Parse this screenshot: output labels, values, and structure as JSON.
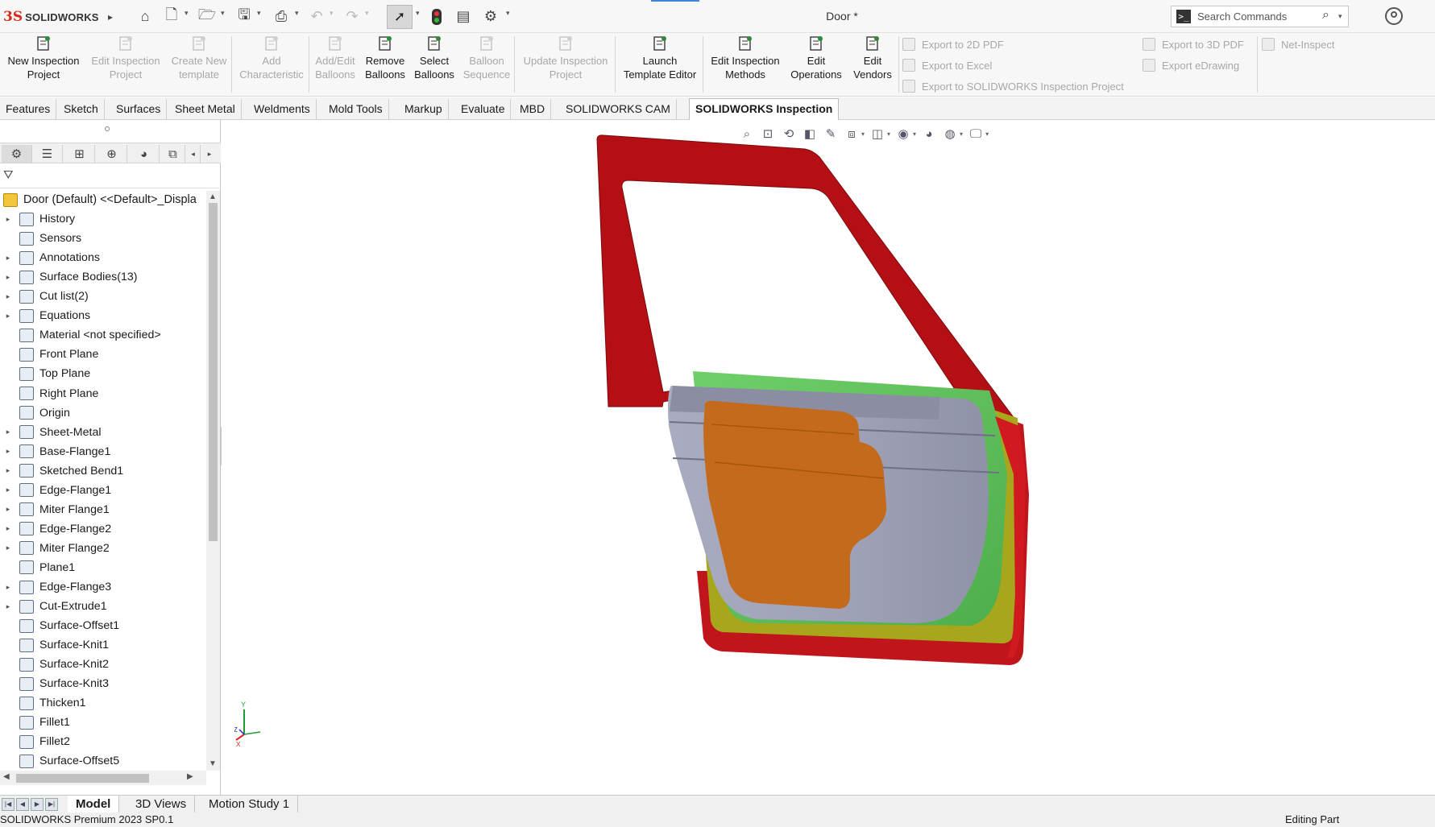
{
  "app": {
    "logo_mark": "3S",
    "logo_text": "SOLIDWORKS",
    "document_title": "Door *",
    "search_placeholder": "Search Commands"
  },
  "ribbon": {
    "buttons": [
      {
        "label1": "New Inspection",
        "label2": "Project",
        "enabled": true
      },
      {
        "label1": "Edit Inspection",
        "label2": "Project",
        "enabled": false
      },
      {
        "label1": "Create New",
        "label2": "template",
        "enabled": false
      },
      {
        "label1": "Add",
        "label2": "Characteristic",
        "enabled": false
      },
      {
        "label1": "Add/Edit",
        "label2": "Balloons",
        "enabled": false
      },
      {
        "label1": "Remove",
        "label2": "Balloons",
        "enabled": true
      },
      {
        "label1": "Select",
        "label2": "Balloons",
        "enabled": true
      },
      {
        "label1": "Balloon",
        "label2": "Sequence",
        "enabled": false
      },
      {
        "label1": "Update Inspection",
        "label2": "Project",
        "enabled": false
      },
      {
        "label1": "Launch",
        "label2": "Template Editor",
        "enabled": true
      },
      {
        "label1": "Edit Inspection",
        "label2": "Methods",
        "enabled": true
      },
      {
        "label1": "Edit",
        "label2": "Operations",
        "enabled": true
      },
      {
        "label1": "Edit",
        "label2": "Vendors",
        "enabled": true
      }
    ],
    "export": {
      "pdf2d": "Export to 2D PDF",
      "excel": "Export to Excel",
      "sw_project": "Export to SOLIDWORKS Inspection Project",
      "pdf3d": "Export to 3D PDF",
      "edrawing": "Export eDrawing",
      "net_inspect": "Net-Inspect"
    }
  },
  "command_tabs": [
    "Features",
    "Sketch",
    "Surfaces",
    "Sheet Metal",
    "Weldments",
    "Mold Tools",
    "Markup",
    "Evaluate",
    "MBD",
    "SOLIDWORKS CAM",
    "SOLIDWORKS Inspection"
  ],
  "command_tabs_active": "SOLIDWORKS Inspection",
  "tree": {
    "root": "Door (Default) <<Default>_Displa",
    "items": [
      {
        "label": "History",
        "expandable": true,
        "icon": "history-icon"
      },
      {
        "label": "Sensors",
        "expandable": false,
        "icon": "sensors-icon"
      },
      {
        "label": "Annotations",
        "expandable": true,
        "icon": "annotations-icon"
      },
      {
        "label": "Surface Bodies(13)",
        "expandable": true,
        "icon": "surface-bodies-icon"
      },
      {
        "label": "Cut list(2)",
        "expandable": true,
        "icon": "cut-list-icon"
      },
      {
        "label": "Equations",
        "expandable": true,
        "icon": "equations-icon"
      },
      {
        "label": "Material <not specified>",
        "expandable": false,
        "icon": "material-icon"
      },
      {
        "label": "Front Plane",
        "expandable": false,
        "icon": "plane-icon"
      },
      {
        "label": "Top Plane",
        "expandable": false,
        "icon": "plane-icon"
      },
      {
        "label": "Right Plane",
        "expandable": false,
        "icon": "plane-icon"
      },
      {
        "label": "Origin",
        "expandable": false,
        "icon": "origin-icon"
      },
      {
        "label": "Sheet-Metal",
        "expandable": true,
        "icon": "sheet-metal-icon"
      },
      {
        "label": "Base-Flange1",
        "expandable": true,
        "icon": "base-flange-icon"
      },
      {
        "label": "Sketched Bend1",
        "expandable": true,
        "icon": "sketched-bend-icon"
      },
      {
        "label": "Edge-Flange1",
        "expandable": true,
        "icon": "edge-flange-icon"
      },
      {
        "label": "Miter Flange1",
        "expandable": true,
        "icon": "miter-flange-icon"
      },
      {
        "label": "Edge-Flange2",
        "expandable": true,
        "icon": "edge-flange-icon"
      },
      {
        "label": "Miter Flange2",
        "expandable": true,
        "icon": "miter-flange-icon"
      },
      {
        "label": "Plane1",
        "expandable": false,
        "icon": "plane-icon"
      },
      {
        "label": "Edge-Flange3",
        "expandable": true,
        "icon": "edge-flange-icon"
      },
      {
        "label": "Cut-Extrude1",
        "expandable": true,
        "icon": "cut-extrude-icon"
      },
      {
        "label": "Surface-Offset1",
        "expandable": false,
        "icon": "surface-offset-icon"
      },
      {
        "label": "Surface-Knit1",
        "expandable": false,
        "icon": "surface-knit-icon"
      },
      {
        "label": "Surface-Knit2",
        "expandable": false,
        "icon": "surface-knit-icon"
      },
      {
        "label": "Surface-Knit3",
        "expandable": false,
        "icon": "surface-knit-icon"
      },
      {
        "label": "Thicken1",
        "expandable": false,
        "icon": "thicken-icon"
      },
      {
        "label": "Fillet1",
        "expandable": false,
        "icon": "fillet-icon"
      },
      {
        "label": "Fillet2",
        "expandable": false,
        "icon": "fillet-icon"
      },
      {
        "label": "Surface-Offset5",
        "expandable": false,
        "icon": "surface-offset-icon"
      }
    ]
  },
  "triad": {
    "x": "X",
    "y": "Y",
    "z": "Z"
  },
  "bottom_tabs": {
    "model": "Model",
    "views3d": "3D Views",
    "motion": "Motion Study 1"
  },
  "status": {
    "left": "SOLIDWORKS Premium 2023 SP0.1",
    "right": "Editing Part"
  },
  "colors": {
    "frame_red": "#b30f14",
    "green": "#5cbf5a",
    "olive": "#a7a61c",
    "gray": "#9ea1b5",
    "orange": "#c46a1c"
  }
}
